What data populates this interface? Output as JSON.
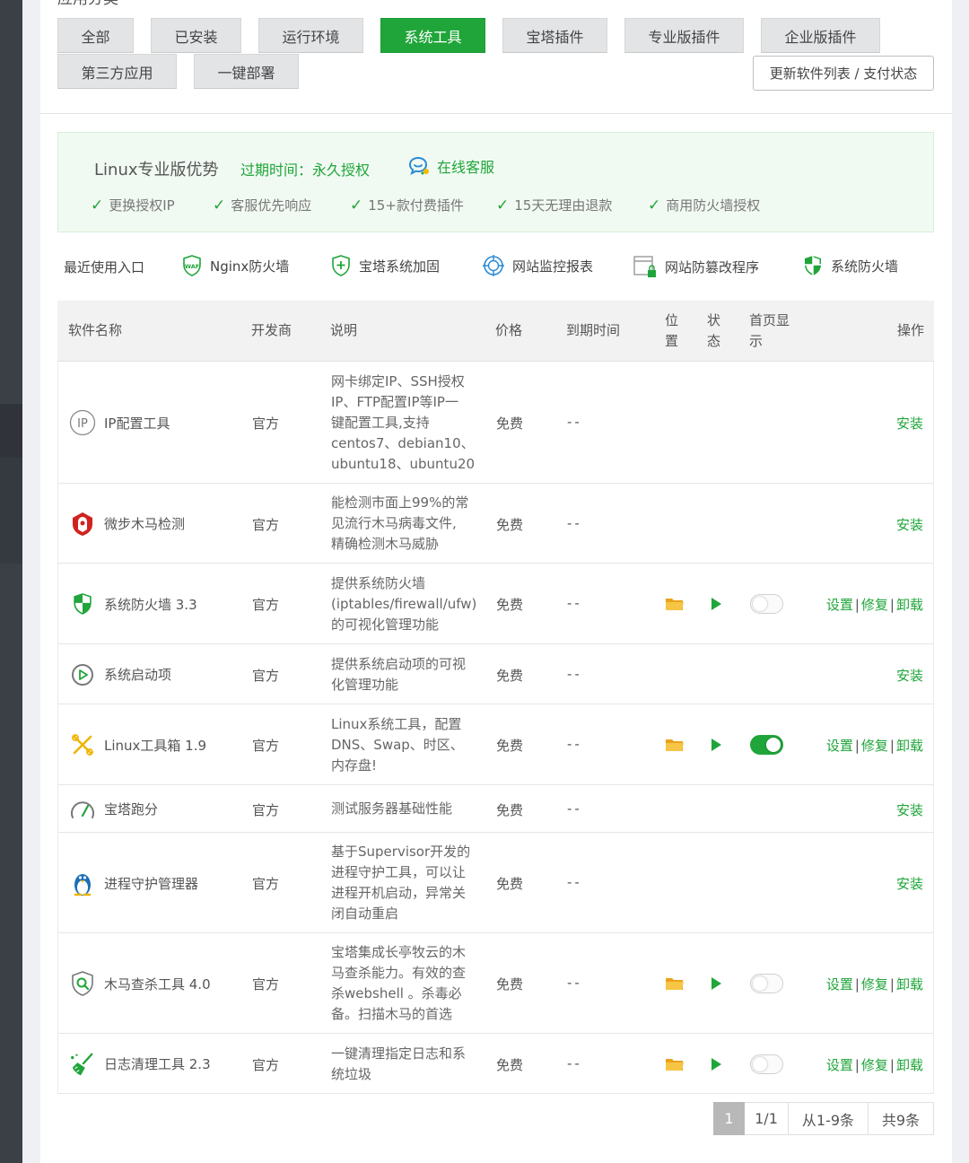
{
  "categories": {
    "title": "应用分类",
    "items": [
      {
        "label": "全部"
      },
      {
        "label": "已安装"
      },
      {
        "label": "运行环境"
      },
      {
        "label": "系统工具"
      },
      {
        "label": "宝塔插件"
      },
      {
        "label": "专业版插件"
      },
      {
        "label": "企业版插件"
      },
      {
        "label": "第三方应用"
      },
      {
        "label": "一键部署"
      }
    ],
    "active": "系统工具",
    "update_button": "更新软件列表 / 支付状态"
  },
  "promo": {
    "title": "Linux专业版优势",
    "expire": "过期时间：永久授权",
    "service": "在线客服",
    "features": [
      "更换授权IP",
      "客服优先响应",
      "15+款付费插件",
      "15天无理由退款",
      "商用防火墙授权"
    ]
  },
  "recent": {
    "label": "最近使用入口",
    "items": [
      {
        "label": "Nginx防火墙",
        "icon": "waf-shield-icon"
      },
      {
        "label": "宝塔系统加固",
        "icon": "shield-plus-icon"
      },
      {
        "label": "网站监控报表",
        "icon": "crosshair-icon"
      },
      {
        "label": "网站防篡改程序",
        "icon": "locked-window-icon"
      },
      {
        "label": "系统防火墙",
        "icon": "firewall-shield-icon"
      }
    ]
  },
  "table": {
    "headers": {
      "name": "软件名称",
      "developer": "开发商",
      "description": "说明",
      "price": "价格",
      "expire": "到期时间",
      "location": [
        "位",
        "置"
      ],
      "status": [
        "状",
        "态"
      ],
      "homepage": [
        "首页显",
        "示"
      ],
      "actions": "操作"
    },
    "action_labels": {
      "install": "安装",
      "settings": "设置",
      "repair": "修复",
      "uninstall": "卸载",
      "separator": "|"
    },
    "rows": [
      {
        "name": "IP配置工具",
        "icon": "ip-icon",
        "developer": "官方",
        "description": [
          "网卡绑定IP、SSH授权",
          "IP、FTP配置IP等IP一",
          "键配置工具,支持",
          "centos7、debian10、",
          "ubuntu18、ubuntu20"
        ],
        "price": "免费",
        "expire": "--",
        "installed": false
      },
      {
        "name": "微步木马检测",
        "icon": "trojan-detect-icon",
        "developer": "官方",
        "description": [
          "能检测市面上99%的常",
          "见流行木马病毒文件,",
          "精确检测木马威胁"
        ],
        "price": "免费",
        "expire": "--",
        "installed": false
      },
      {
        "name": "系统防火墙 3.3",
        "icon": "firewall-shield-icon",
        "developer": "官方",
        "description": [
          "提供系统防火墙",
          "(iptables/firewall/ufw)",
          "的可视化管理功能"
        ],
        "price": "免费",
        "expire": "--",
        "installed": true,
        "homepage": false
      },
      {
        "name": "系统启动项",
        "icon": "startup-icon",
        "developer": "官方",
        "description": [
          "提供系统启动项的可视",
          "化管理功能"
        ],
        "price": "免费",
        "expire": "--",
        "installed": false
      },
      {
        "name": "Linux工具箱 1.9",
        "icon": "toolbox-icon",
        "developer": "官方",
        "description": [
          "Linux系统工具，配置",
          "DNS、Swap、时区、",
          "内存盘!"
        ],
        "price": "免费",
        "expire": "--",
        "installed": true,
        "homepage": true
      },
      {
        "name": "宝塔跑分",
        "icon": "speedometer-icon",
        "developer": "官方",
        "description": [
          "测试服务器基础性能"
        ],
        "price": "免费",
        "expire": "--",
        "installed": false
      },
      {
        "name": "进程守护管理器",
        "icon": "penguin-icon",
        "developer": "官方",
        "description": [
          "基于Supervisor开发的",
          "进程守护工具，可以让",
          "进程开机启动，异常关",
          "闭自动重启"
        ],
        "price": "免费",
        "expire": "--",
        "installed": false
      },
      {
        "name": "木马查杀工具 4.0",
        "icon": "virus-scan-icon",
        "developer": "官方",
        "description": [
          "宝塔集成长亭牧云的木",
          "马查杀能力。有效的查",
          "杀webshell 。杀毒必",
          "备。扫描木马的首选"
        ],
        "price": "免费",
        "expire": "--",
        "installed": true,
        "homepage": false
      },
      {
        "name": "日志清理工具 2.3",
        "icon": "broom-icon",
        "developer": "官方",
        "description": [
          "一键清理指定日志和系",
          "统垃圾"
        ],
        "price": "免费",
        "expire": "--",
        "installed": true,
        "homepage": false
      }
    ]
  },
  "pagination": {
    "current": "1",
    "pages": "1/1",
    "range": "从1-9条",
    "total": "共9条"
  },
  "colors": {
    "accent": "#20a53a",
    "header_bg": "#f2f2f2",
    "promo_bg": "#f1faf2"
  }
}
